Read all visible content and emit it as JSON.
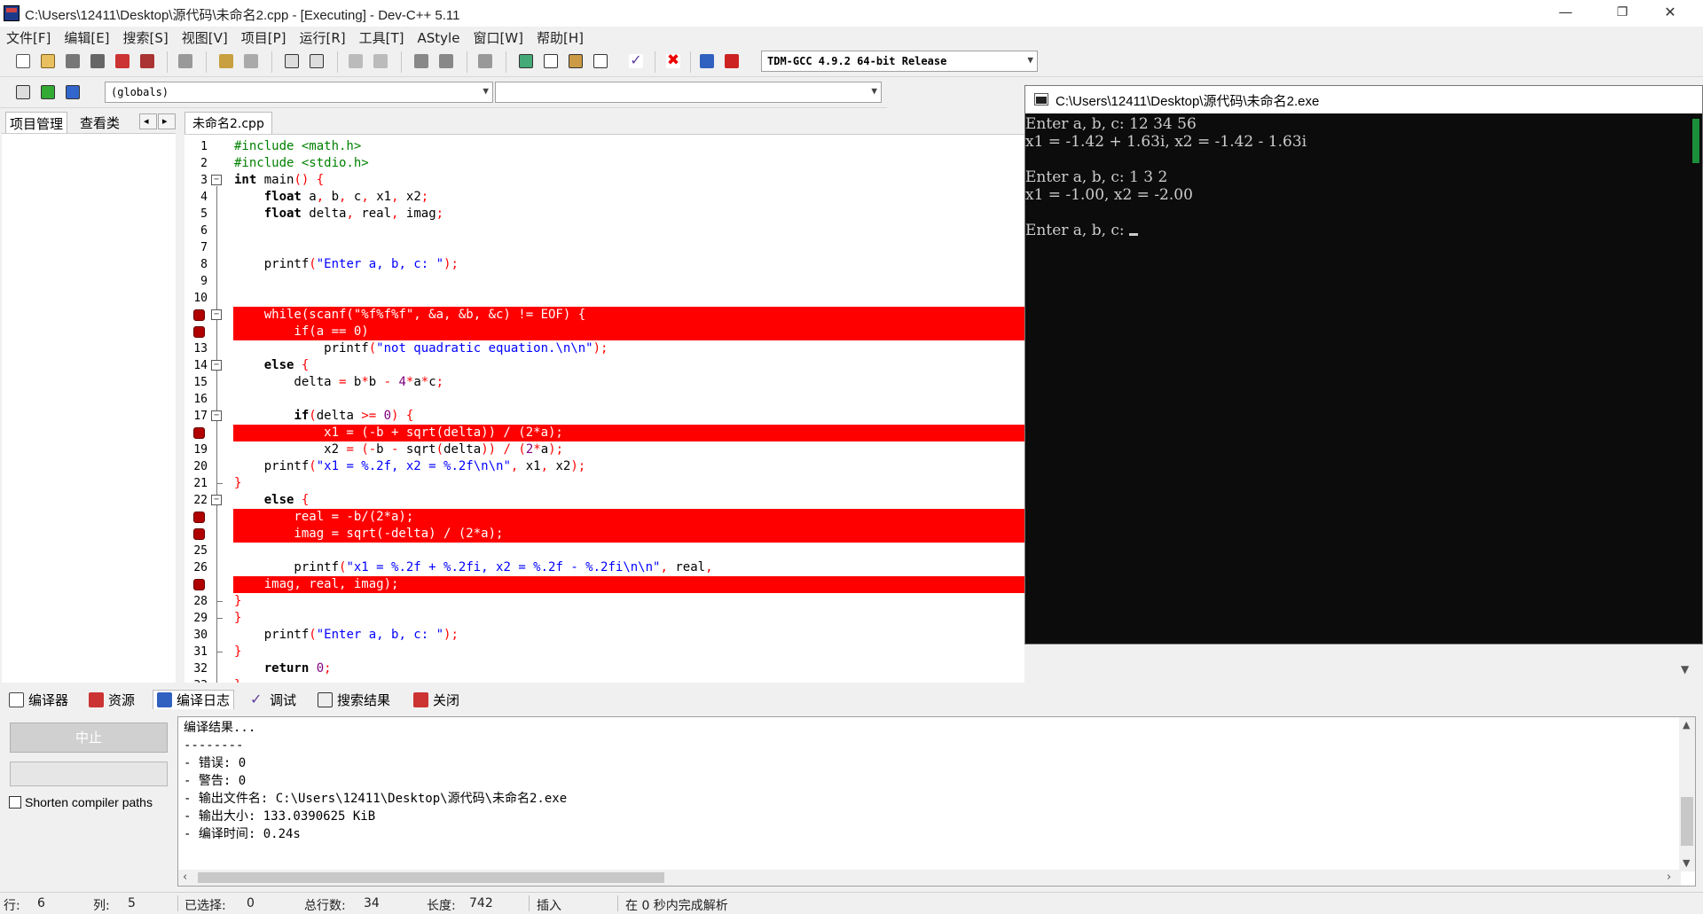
{
  "window": {
    "title": "C:\\Users\\12411\\Desktop\\源代码\\未命名2.cpp - [Executing] - Dev-C++ 5.11",
    "minimize": "—",
    "restore": "❐",
    "close": "✕"
  },
  "menu": [
    "文件[F]",
    "编辑[E]",
    "搜索[S]",
    "视图[V]",
    "项目[P]",
    "运行[R]",
    "工具[T]",
    "AStyle",
    "窗口[W]",
    "帮助[H]"
  ],
  "toolbar": {
    "compiler_select": "TDM-GCC 4.9.2 64-bit Release",
    "scope_select": "(globals)",
    "member_select": ""
  },
  "left_panel": {
    "tabs": [
      "项目管理",
      "查看类"
    ],
    "nav_prev": "◂",
    "nav_next": "▸"
  },
  "editor": {
    "tab_label": "未命名2.cpp",
    "lines": [
      {
        "n": "1",
        "html": "<span class=\"pp\">#include &lt;math.h&gt;</span>"
      },
      {
        "n": "2",
        "html": "<span class=\"pp\">#include &lt;stdio.h&gt;</span>"
      },
      {
        "n": "3",
        "html": "<span class=\"kw\">int</span> main<span class=\"sy\">()</span> <span class=\"sy\">{</span>"
      },
      {
        "n": "4",
        "html": "    <span class=\"kw\">float</span> a<span class=\"sy\">,</span> b<span class=\"sy\">,</span> c<span class=\"sy\">,</span> x1<span class=\"sy\">,</span> x2<span class=\"sy\">;</span>"
      },
      {
        "n": "5",
        "html": "    <span class=\"kw\">float</span> delta<span class=\"sy\">,</span> real<span class=\"sy\">,</span> imag<span class=\"sy\">;</span>"
      },
      {
        "n": "6",
        "html": ""
      },
      {
        "n": "7",
        "html": ""
      },
      {
        "n": "8",
        "html": "    printf<span class=\"sy\">(</span><span class=\"st\">\"Enter a, b, c: \"</span><span class=\"sy\">);</span>"
      },
      {
        "n": "9",
        "html": ""
      },
      {
        "n": "10",
        "html": ""
      },
      {
        "n": "",
        "html": "    while(scanf(\"%f%f%f\", &amp;a, &amp;b, &amp;c) != EOF) {"
      },
      {
        "n": "",
        "html": "        if(a == 0)"
      },
      {
        "n": "13",
        "html": "            printf<span class=\"sy\">(</span><span class=\"st\">\"not quadratic equation.\\n\\n\"</span><span class=\"sy\">);</span>"
      },
      {
        "n": "14",
        "html": "    <span class=\"kw\">else</span> <span class=\"sy\">{</span>"
      },
      {
        "n": "15",
        "html": "        delta <span class=\"sy\">=</span> b<span class=\"sy\">*</span>b <span class=\"sy\">-</span> <span class=\"nm\">4</span><span class=\"sy\">*</span>a<span class=\"sy\">*</span>c<span class=\"sy\">;</span>"
      },
      {
        "n": "16",
        "html": ""
      },
      {
        "n": "17",
        "html": "        <span class=\"kw\">if</span><span class=\"sy\">(</span>delta <span class=\"sy\">&gt;=</span> <span class=\"nm\">0</span><span class=\"sy\">)</span> <span class=\"sy\">{</span>"
      },
      {
        "n": "",
        "html": "            x1 = (-b + sqrt(delta)) / (2*a);"
      },
      {
        "n": "19",
        "html": "            x2 <span class=\"sy\">=</span> <span class=\"sy\">(-</span>b <span class=\"sy\">-</span> sqrt<span class=\"sy\">(</span>delta<span class=\"sy\">))</span> <span class=\"sy\">/</span> <span class=\"sy\">(</span><span class=\"nm\">2</span><span class=\"sy\">*</span>a<span class=\"sy\">);</span>"
      },
      {
        "n": "20",
        "html": "    printf<span class=\"sy\">(</span><span class=\"st\">\"x1 = %.2f, x2 = %.2f\\n\\n\"</span><span class=\"sy\">,</span> x1<span class=\"sy\">,</span> x2<span class=\"sy\">);</span>"
      },
      {
        "n": "21",
        "html": "<span class=\"sy\">}</span>"
      },
      {
        "n": "22",
        "html": "    <span class=\"kw\">else</span> <span class=\"sy\">{</span>"
      },
      {
        "n": "",
        "html": "        real = -b/(2*a);"
      },
      {
        "n": "",
        "html": "        imag = sqrt(-delta) / (2*a);"
      },
      {
        "n": "25",
        "html": ""
      },
      {
        "n": "26",
        "html": "        printf<span class=\"sy\">(</span><span class=\"st\">\"x1 = %.2f + %.2fi, x2 = %.2f - %.2fi\\n\\n\"</span><span class=\"sy\">,</span> real<span class=\"sy\">,</span>"
      },
      {
        "n": "",
        "html": "    imag, real, imag);"
      },
      {
        "n": "28",
        "html": "<span class=\"sy\">}</span>"
      },
      {
        "n": "29",
        "html": "<span class=\"sy\">}</span>"
      },
      {
        "n": "30",
        "html": "    printf<span class=\"sy\">(</span><span class=\"st\">\"Enter a, b, c: \"</span><span class=\"sy\">);</span>"
      },
      {
        "n": "31",
        "html": "<span class=\"sy\">}</span>"
      },
      {
        "n": "32",
        "html": "    <span class=\"kw\">return</span> <span class=\"nm\">0</span><span class=\"sy\">;</span>"
      },
      {
        "n": "33",
        "html": "<span class=\"sy\">}</span>"
      }
    ],
    "breakpoint_lines": [
      11,
      12,
      18,
      23,
      24,
      27
    ],
    "current_line": 6
  },
  "console": {
    "title": "C:\\Users\\12411\\Desktop\\源代码\\未命名2.exe",
    "lines": [
      "Enter a, b, c: 12 34 56",
      "x1 = -1.42 + 1.63i, x2 = -1.42 - 1.63i",
      "",
      "Enter a, b, c: 1 3 2",
      "x1 = -1.00, x2 = -2.00",
      "",
      "Enter a, b, c: "
    ]
  },
  "bottom_tabs": [
    "编译器",
    "资源",
    "编译日志",
    "调试",
    "搜索结果",
    "关闭"
  ],
  "compile": {
    "abort_label": "中止",
    "shorten_label": "Shorten compiler paths",
    "log": "编译结果...\n--------\n- 错误: 0\n- 警告: 0\n- 输出文件名: C:\\Users\\12411\\Desktop\\源代码\\未命名2.exe\n- 输出大小: 133.0390625 KiB\n- 编译时间: 0.24s"
  },
  "status": {
    "row_label": "行:",
    "row": "6",
    "col_label": "列:",
    "col": "5",
    "sel_label": "已选择:",
    "sel": "0",
    "lines_label": "总行数:",
    "lines": "34",
    "len_label": "长度:",
    "len": "742",
    "mode": "插入",
    "parse": "在 0 秒内完成解析"
  },
  "colors": {
    "breakpoint": "#ff0000",
    "current_line": "#ccffff",
    "console_bg": "#0c0c0c",
    "preprocessor": "#008000",
    "string": "#0000ff",
    "number": "#800080",
    "symbol": "#ff0000"
  }
}
